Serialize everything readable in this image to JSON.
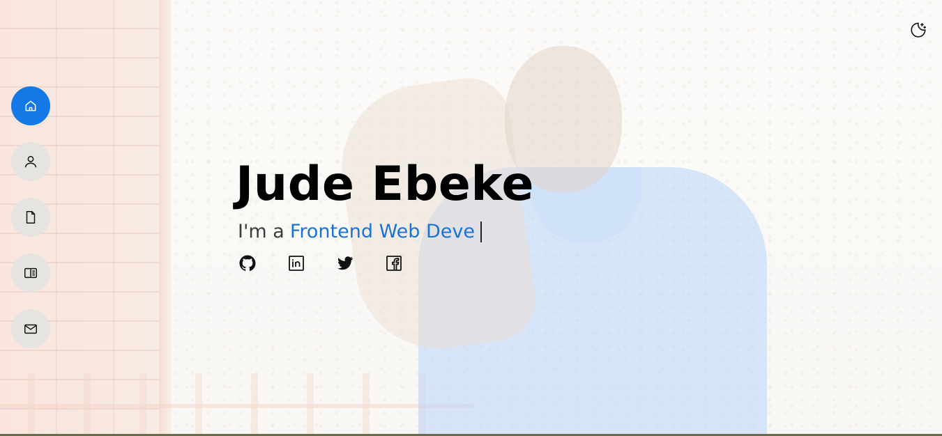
{
  "hero": {
    "name": "Jude Ebeke",
    "tagline_prefix": "I'm a",
    "tagline_role": "Frontend Web Deve"
  },
  "side_nav": {
    "items": [
      {
        "icon": "home-icon",
        "active": true
      },
      {
        "icon": "user-icon",
        "active": false
      },
      {
        "icon": "file-icon",
        "active": false
      },
      {
        "icon": "portfolio-icon",
        "active": false
      },
      {
        "icon": "mail-icon",
        "active": false
      }
    ]
  },
  "socials": [
    "github-icon",
    "linkedin-icon",
    "twitter-icon",
    "facebook-icon"
  ],
  "theme_toggle": {
    "icon": "moon-stars-icon"
  },
  "colors": {
    "accent": "#1479e6",
    "role_text": "#1a73d4",
    "nav_bg": "#e6e4e1",
    "name_text": "#000000"
  }
}
